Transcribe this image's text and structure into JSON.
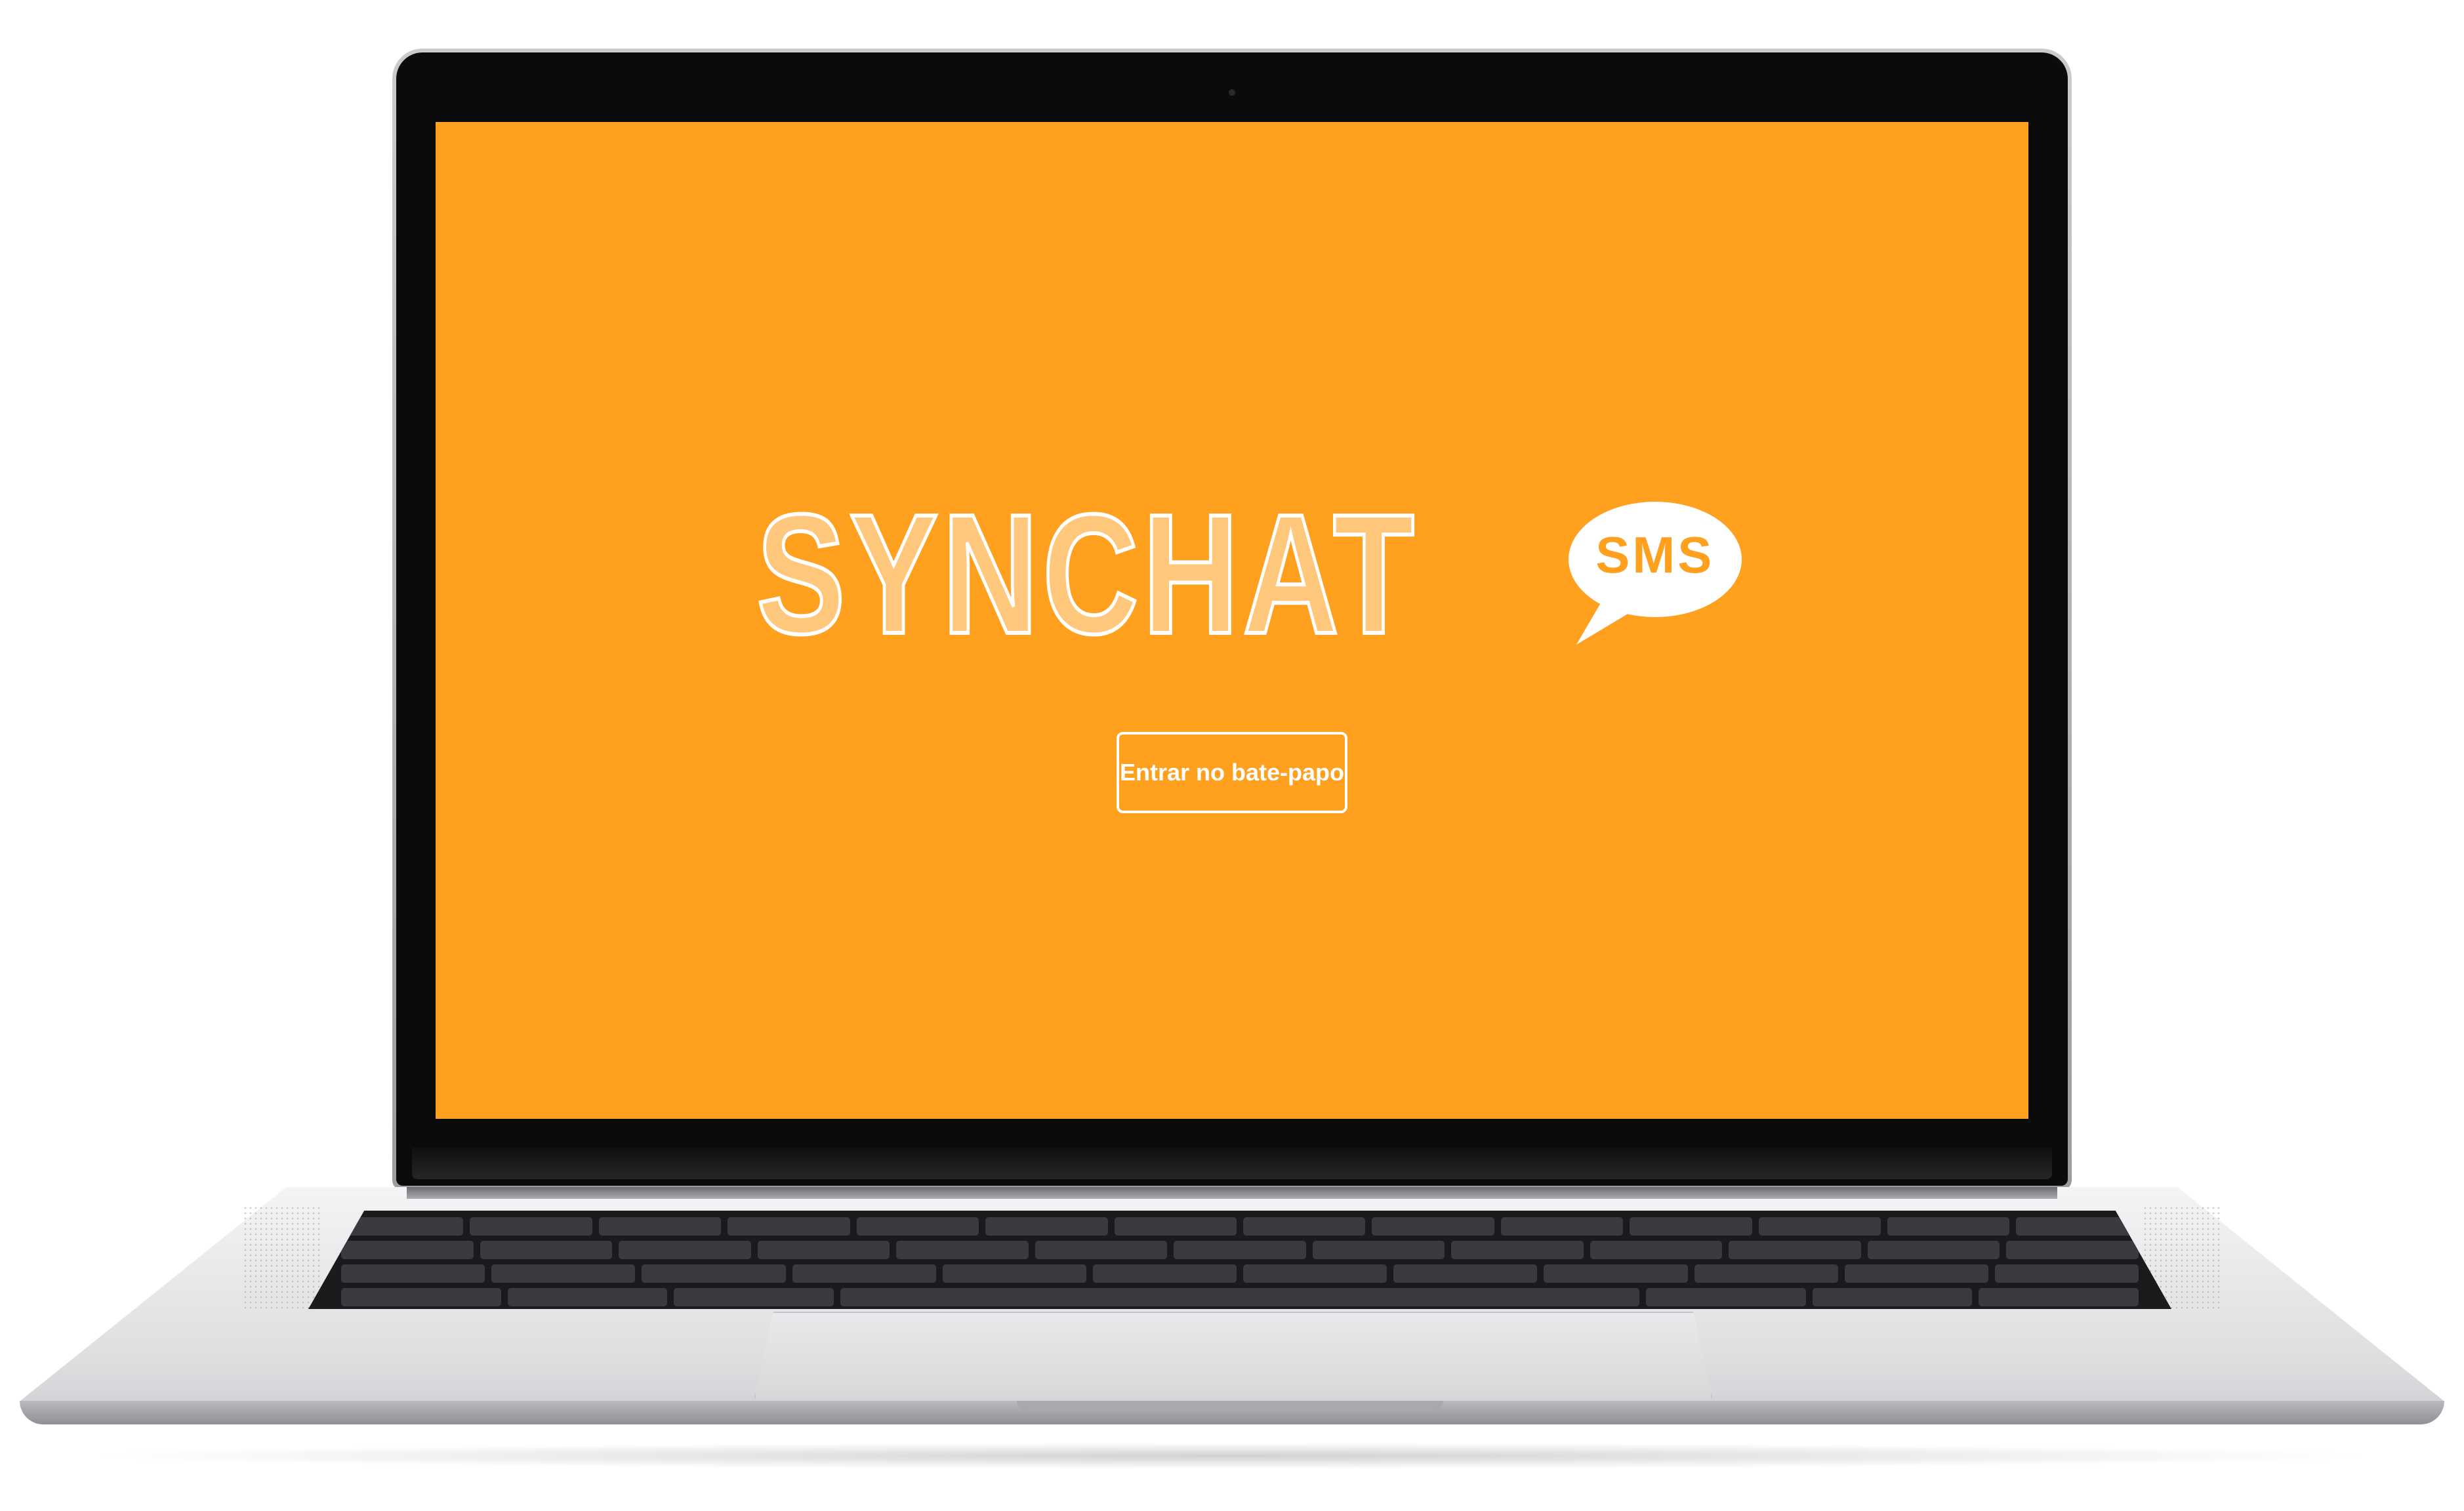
{
  "app": {
    "brand_title": "SYNCHAT",
    "bubble_label": "SMS",
    "enter_button_label": "Entrar no bate-papo"
  },
  "colors": {
    "background": "#ffa01f",
    "text": "#ffffff"
  },
  "icons": {
    "chat_bubble": "sms-bubble-icon"
  }
}
